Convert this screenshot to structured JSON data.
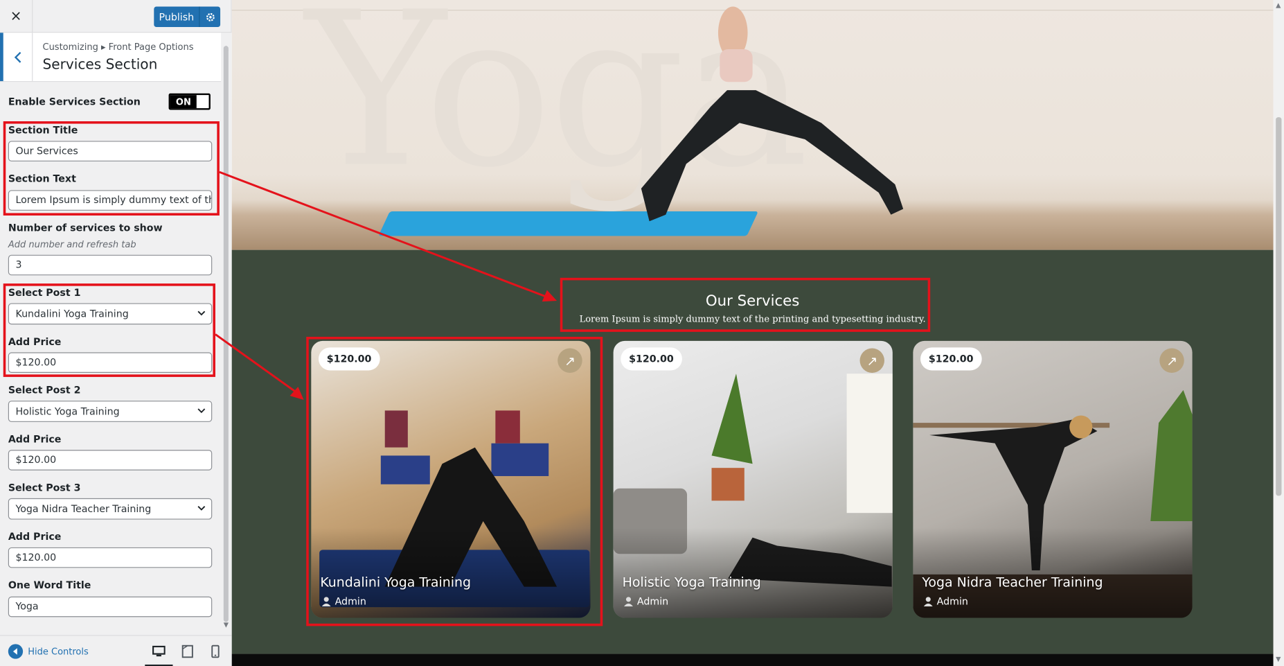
{
  "header": {
    "close_icon": "×",
    "publish_label": "Publish"
  },
  "section": {
    "breadcrumb_prefix": "Customizing",
    "breadcrumb_sep": "▸",
    "breadcrumb_page": "Front Page Options",
    "title": "Services Section"
  },
  "controls": {
    "enable_label": "Enable Services Section",
    "toggle_state": "ON",
    "section_title_label": "Section Title",
    "section_title_value": "Our Services",
    "section_text_label": "Section Text",
    "section_text_value": "Lorem Ipsum is simply dummy text of the pr",
    "num_services_label": "Number of services to show",
    "num_services_desc": "Add number and refresh tab",
    "num_services_value": "3",
    "posts": [
      {
        "select_label": "Select Post 1",
        "select_value": "Kundalini Yoga Training",
        "price_label": "Add Price",
        "price_value": "$120.00"
      },
      {
        "select_label": "Select Post 2",
        "select_value": "Holistic Yoga Training",
        "price_label": "Add Price",
        "price_value": "$120.00"
      },
      {
        "select_label": "Select Post 3",
        "select_value": "Yoga Nidra Teacher Training",
        "price_label": "Add Price",
        "price_value": "$120.00"
      }
    ],
    "one_word_label": "One Word Title",
    "one_word_value": "Yoga"
  },
  "footer": {
    "hide_controls": "Hide Controls",
    "devices": [
      "desktop-icon",
      "tablet-icon",
      "mobile-icon"
    ]
  },
  "preview": {
    "hero_word": "Yoga",
    "services_title": "Our Services",
    "services_text": "Lorem Ipsum is simply dummy text of the printing and typesetting industry.",
    "cards": [
      {
        "price": "$120.00",
        "title": "Kundalini Yoga Training",
        "author": "Admin"
      },
      {
        "price": "$120.00",
        "title": "Holistic Yoga Training",
        "author": "Admin"
      },
      {
        "price": "$120.00",
        "title": "Yoga Nidra Teacher Training",
        "author": "Admin"
      }
    ]
  },
  "colors": {
    "accent": "#2271b1",
    "highlight": "#e4121b",
    "services_bg": "#3d4a3c",
    "mat": "#2aa3dc",
    "arrow_badge": "#b7a380"
  }
}
